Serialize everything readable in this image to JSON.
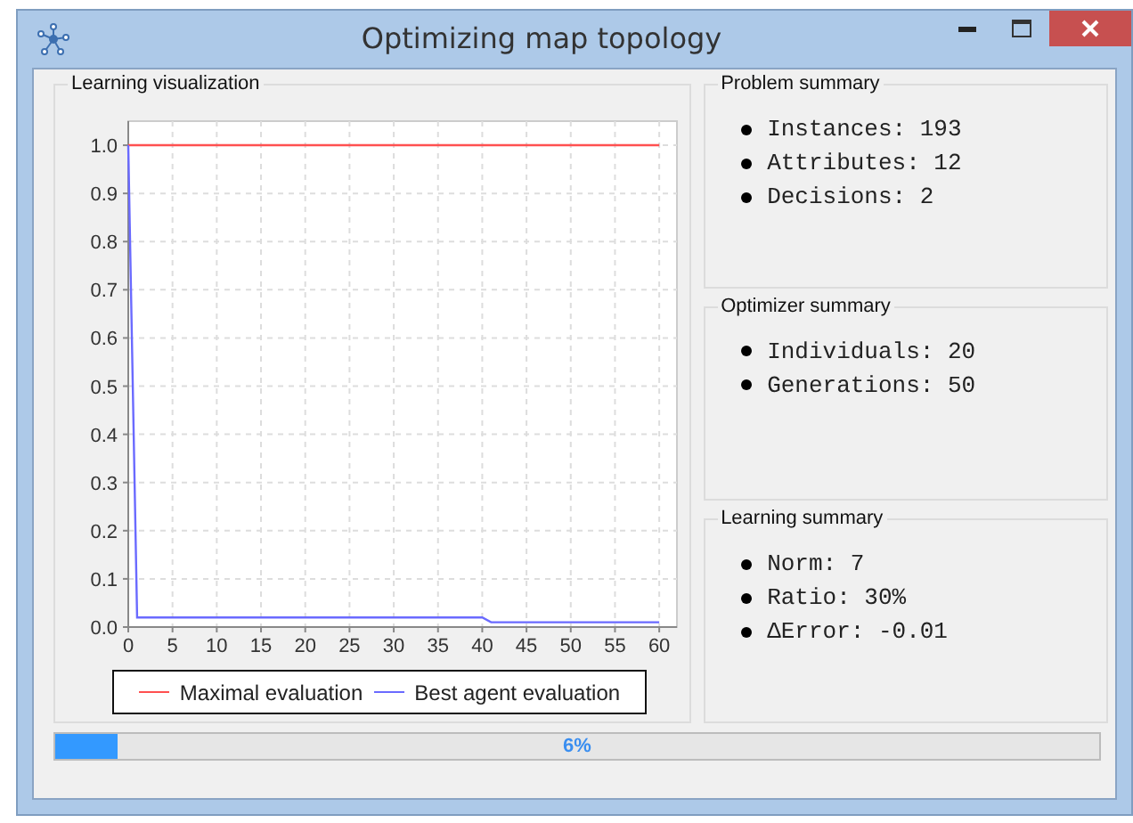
{
  "window": {
    "title": "Optimizing map topology"
  },
  "visualization": {
    "title": "Learning visualization",
    "chart_data": {
      "type": "line",
      "grid": true,
      "legend": true,
      "x": [
        0,
        1,
        40,
        41,
        60
      ],
      "xlim": [
        0,
        62
      ],
      "ylim": [
        0,
        1.05
      ],
      "xticks": [
        0,
        5,
        10,
        15,
        20,
        25,
        30,
        35,
        40,
        45,
        50,
        55,
        60
      ],
      "yticks": [
        {
          "value": 0,
          "label": "0.0"
        },
        {
          "value": 0.1,
          "label": "0.1"
        },
        {
          "value": 0.2,
          "label": "0.2"
        },
        {
          "value": 0.3,
          "label": "0.3"
        },
        {
          "value": 0.4,
          "label": "0.4"
        },
        {
          "value": 0.5,
          "label": "0.5"
        },
        {
          "value": 0.6,
          "label": "0.6"
        },
        {
          "value": 0.7,
          "label": "0.7"
        },
        {
          "value": 0.8,
          "label": "0.8"
        },
        {
          "value": 0.9,
          "label": "0.9"
        },
        {
          "value": 1,
          "label": "1.0"
        }
      ],
      "series": [
        {
          "name": "Maximal evaluation",
          "color": "#ff5050",
          "values": [
            1,
            1,
            1,
            1,
            1
          ]
        },
        {
          "name": "Best agent evaluation",
          "color": "#6a6aff",
          "values": [
            1,
            0.02,
            0.02,
            0.01,
            0.01
          ]
        }
      ]
    }
  },
  "summaries": [
    {
      "title": "Problem summary",
      "items": [
        "Instances: 193",
        "Attributes: 12",
        "Decisions: 2"
      ]
    },
    {
      "title": "Optimizer summary",
      "items": [
        "Individuals: 20",
        "Generations: 50"
      ]
    },
    {
      "title": "Learning summary",
      "items": [
        "Norm: 7",
        "Ratio: 30%",
        "ΔError: -0.01"
      ]
    }
  ],
  "progress": {
    "level": 0.06,
    "text": "6%"
  }
}
